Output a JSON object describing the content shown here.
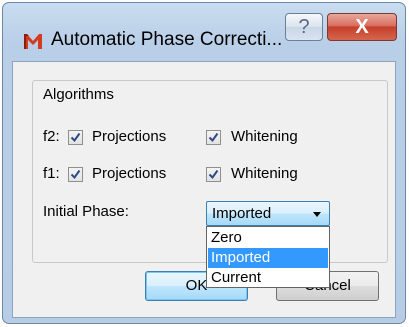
{
  "window": {
    "title": "Automatic Phase Correcti..."
  },
  "titlebar": {
    "help_glyph": "?",
    "close_glyph": "X"
  },
  "group": {
    "title": "Algorithms"
  },
  "rows": [
    {
      "label": "f2:",
      "options": [
        {
          "label": "Projections",
          "checked": true
        },
        {
          "label": "Whitening",
          "checked": true
        }
      ]
    },
    {
      "label": "f1:",
      "options": [
        {
          "label": "Projections",
          "checked": true
        },
        {
          "label": "Whitening",
          "checked": true
        }
      ]
    }
  ],
  "initial_phase": {
    "label": "Initial Phase:",
    "selected": "Imported",
    "options": [
      "Zero",
      "Imported",
      "Current"
    ]
  },
  "buttons": {
    "ok": "OK",
    "cancel": "Cancel"
  },
  "colors": {
    "selection": "#3399ff",
    "title_bg": "#b9cfe8",
    "close": "#c4402a",
    "app_icon": "#d33c1e"
  }
}
